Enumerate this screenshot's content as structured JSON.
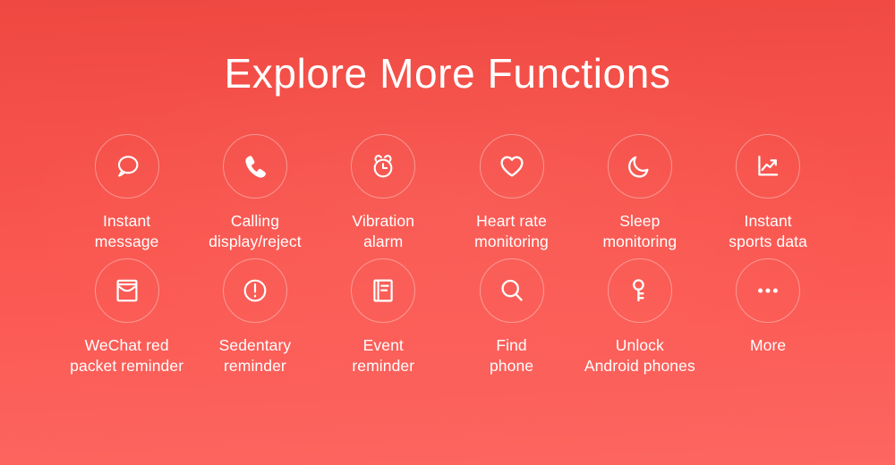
{
  "header": {
    "title": "Explore More Functions"
  },
  "theme": {
    "background_top": "#ee4841",
    "background_bottom": "#fd6661",
    "text_color": "#ffffff",
    "circle_stroke": "rgba(255,255,255,0.38)"
  },
  "features": {
    "row1": [
      {
        "icon": "chat-bubble-icon",
        "label": "Instant\nmessage"
      },
      {
        "icon": "phone-call-icon",
        "label": "Calling\ndisplay/reject"
      },
      {
        "icon": "alarm-clock-icon",
        "label": "Vibration\nalarm"
      },
      {
        "icon": "heart-icon",
        "label": "Heart rate\nmonitoring"
      },
      {
        "icon": "moon-icon",
        "label": "Sleep\nmonitoring"
      },
      {
        "icon": "line-chart-icon",
        "label": "Instant\nsports data"
      }
    ],
    "row2": [
      {
        "icon": "envelope-inbox-icon",
        "label": "WeChat red\npacket reminder"
      },
      {
        "icon": "exclamation-circle-icon",
        "label": "Sedentary\nreminder"
      },
      {
        "icon": "document-note-icon",
        "label": "Event\nreminder"
      },
      {
        "icon": "magnifier-search-icon",
        "label": "Find\nphone"
      },
      {
        "icon": "key-icon",
        "label": "Unlock\nAndroid phones"
      },
      {
        "icon": "ellipsis-more-icon",
        "label": "More"
      }
    ]
  }
}
